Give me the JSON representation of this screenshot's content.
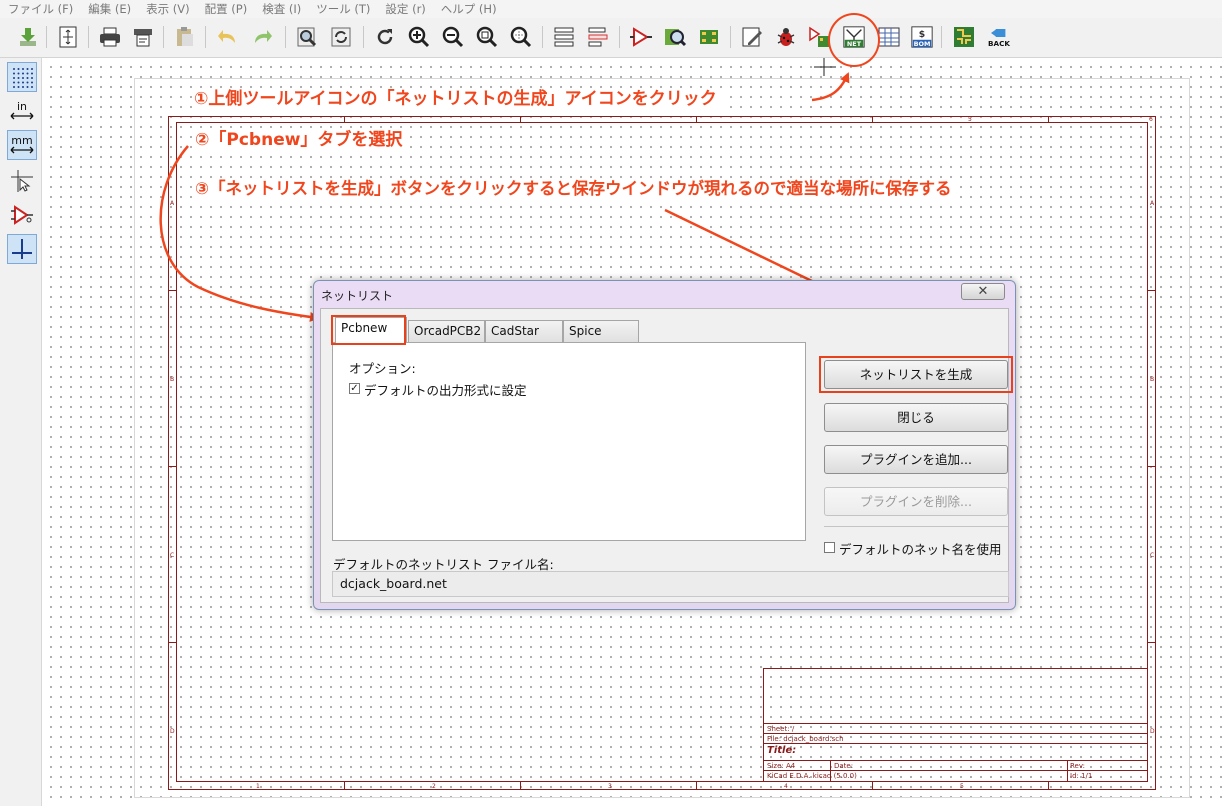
{
  "menu": [
    "ファイル (F)",
    "編集 (E)",
    "表示 (V)",
    "配置 (P)",
    "検査 (I)",
    "ツール (T)",
    "設定 (r)",
    "ヘルプ (H)"
  ],
  "toolbar": {
    "net_label": "NET",
    "bom_label": "BOM",
    "bom_symbol": "$",
    "back_label": "BACK"
  },
  "left_toolbar": {
    "in_label": "in",
    "mm_label": "mm"
  },
  "annotations": {
    "step1": "①上側ツールアイコンの「ネットリストの生成」アイコンをクリック",
    "step2": "②「Pcbnew」タブを選択",
    "step3": "③「ネットリストを生成」ボタンをクリックすると保存ウインドウが現れるので適当な場所に保存する"
  },
  "dialog": {
    "title": "ネットリスト",
    "close_symbol": "✕",
    "tabs": [
      "Pcbnew",
      "OrcadPCB2",
      "CadStar",
      "Spice"
    ],
    "options_label": "オプション:",
    "default_format_label": "デフォルトの出力形式に設定",
    "default_format_checked": true,
    "buttons": {
      "generate": "ネットリストを生成",
      "close": "閉じる",
      "add_plugin": "プラグインを追加...",
      "remove_plugin": "プラグインを削除..."
    },
    "use_default_net_name_label": "デフォルトのネット名を使用",
    "use_default_net_name_checked": false,
    "filename_label": "デフォルトのネットリスト ファイル名:",
    "filename_value": "dcjack_board.net"
  },
  "title_block": {
    "sheet": "Sheet: /",
    "file": "File: dcjack_board.sch",
    "title": "Title:",
    "size": "Size: A4",
    "date": "Date:",
    "rev": "Rev:",
    "tool": "KiCad E.D.A.  kicad (5.0.0)",
    "id": "Id: 1/1"
  },
  "frame_zones": {
    "top": [
      "1",
      "2",
      "3",
      "4",
      "5",
      "6"
    ],
    "side": [
      "A",
      "B",
      "C",
      "D"
    ]
  },
  "colors": {
    "annotation": "#f0461e",
    "frame": "#8b1a1a",
    "dialog_frame": "#e3d7f0"
  }
}
